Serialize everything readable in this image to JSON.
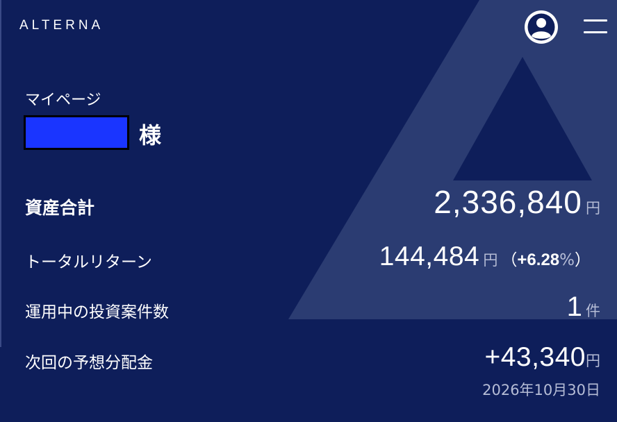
{
  "header": {
    "brand": "ALTERNA",
    "account_icon": "user-circle-icon",
    "menu_icon": "hamburger-menu-icon"
  },
  "profile": {
    "page_title": "マイページ",
    "name_redacted": "",
    "honorific": "様"
  },
  "summary": {
    "total_assets": {
      "label": "資産合計",
      "value": "2,336,840",
      "unit": "円"
    },
    "total_return": {
      "label": "トータルリターン",
      "value": "144,484",
      "unit": "円",
      "paren_open": "（",
      "percent": "+6.28",
      "percent_sign": "%",
      "paren_close": "）"
    },
    "active_investments": {
      "label": "運用中の投資案件数",
      "value": "1",
      "unit": "件"
    },
    "next_dividend": {
      "label": "次回の予想分配金",
      "value": "+43,340",
      "unit": "円",
      "date": "2026年10月30日"
    }
  },
  "colors": {
    "background": "#0e1e5a",
    "redaction_fill": "#1a35ff",
    "muted_text": "#b6bdd6"
  }
}
